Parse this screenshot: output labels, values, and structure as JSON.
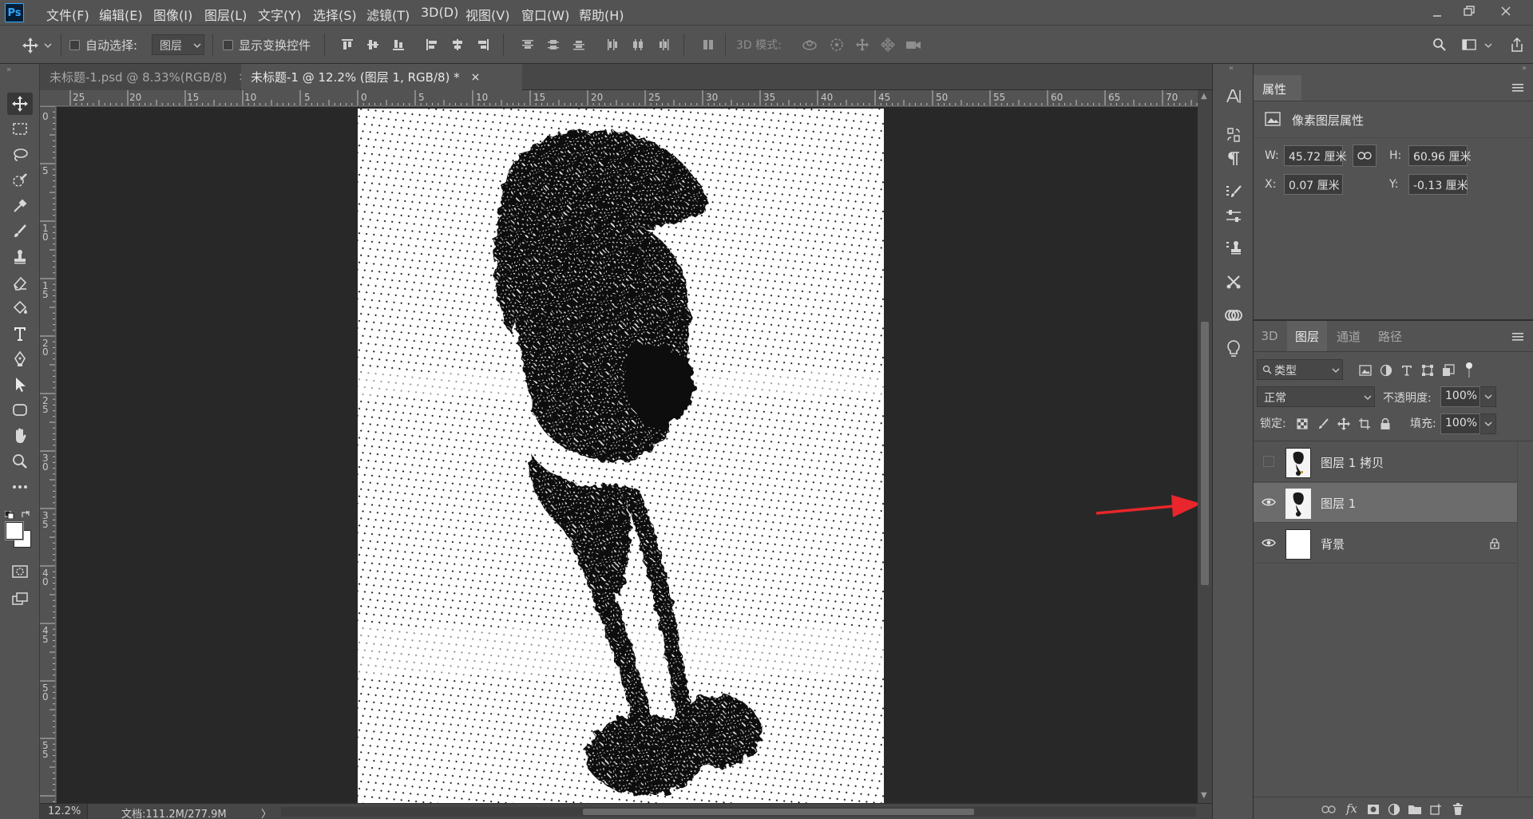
{
  "app": {
    "logo": "Ps"
  },
  "menu": [
    "文件(F)",
    "编辑(E)",
    "图像(I)",
    "图层(L)",
    "文字(Y)",
    "选择(S)",
    "滤镜(T)",
    "3D(D)",
    "视图(V)",
    "窗口(W)",
    "帮助(H)"
  ],
  "options": {
    "auto_select_label": "自动选择:",
    "auto_select_target": "图层",
    "show_transform_label": "显示变换控件",
    "mode_3d_label": "3D 模式:"
  },
  "tabs": [
    {
      "label": "未标题-1.psd @ 8.33%(RGB/8)",
      "close": "×",
      "active": false
    },
    {
      "label": "未标题-1 @ 12.2% (图层 1, RGB/8) *",
      "close": "×",
      "active": true
    }
  ],
  "rulers": {
    "top": [
      "25",
      "20",
      "15",
      "10",
      "5",
      "0",
      "5",
      "10",
      "15",
      "20",
      "25",
      "30",
      "35",
      "40",
      "45",
      "50",
      "55",
      "60",
      "65",
      "70"
    ],
    "left": [
      "0",
      "5",
      "1\n0",
      "1\n5",
      "2\n0",
      "2\n5",
      "3\n0",
      "3\n5",
      "4\n0",
      "4\n5",
      "5\n0",
      "5\n5"
    ]
  },
  "status": {
    "zoom": "12.2%",
    "doc": "文档:111.2M/277.9M",
    "arrow": "〉"
  },
  "properties": {
    "tab_label": "属性",
    "section_title": "像素图层属性",
    "w_label": "W:",
    "w_value": "45.72 厘米",
    "h_label": "H:",
    "h_value": "60.96 厘米",
    "x_label": "X:",
    "x_value": "0.07 厘米",
    "y_label": "Y:",
    "y_value": "-0.13 厘米"
  },
  "layers_panel": {
    "tabs": [
      "3D",
      "图层",
      "通道",
      "路径"
    ],
    "active_tab": "图层",
    "filter_label": "类型",
    "blend_mode": "正常",
    "opacity_label": "不透明度:",
    "opacity_value": "100%",
    "lock_label": "锁定:",
    "fill_label": "填充:",
    "fill_value": "100%",
    "layers": [
      {
        "name": "图层 1 拷贝",
        "visible": false,
        "selected": false,
        "locked": false
      },
      {
        "name": "图层 1",
        "visible": true,
        "selected": true,
        "locked": false
      },
      {
        "name": "背景",
        "visible": true,
        "selected": false,
        "locked": true
      }
    ]
  },
  "colors": {
    "annotation_arrow": "#e8262b",
    "ps_blue": "#31a8ff",
    "background": "#535353"
  }
}
